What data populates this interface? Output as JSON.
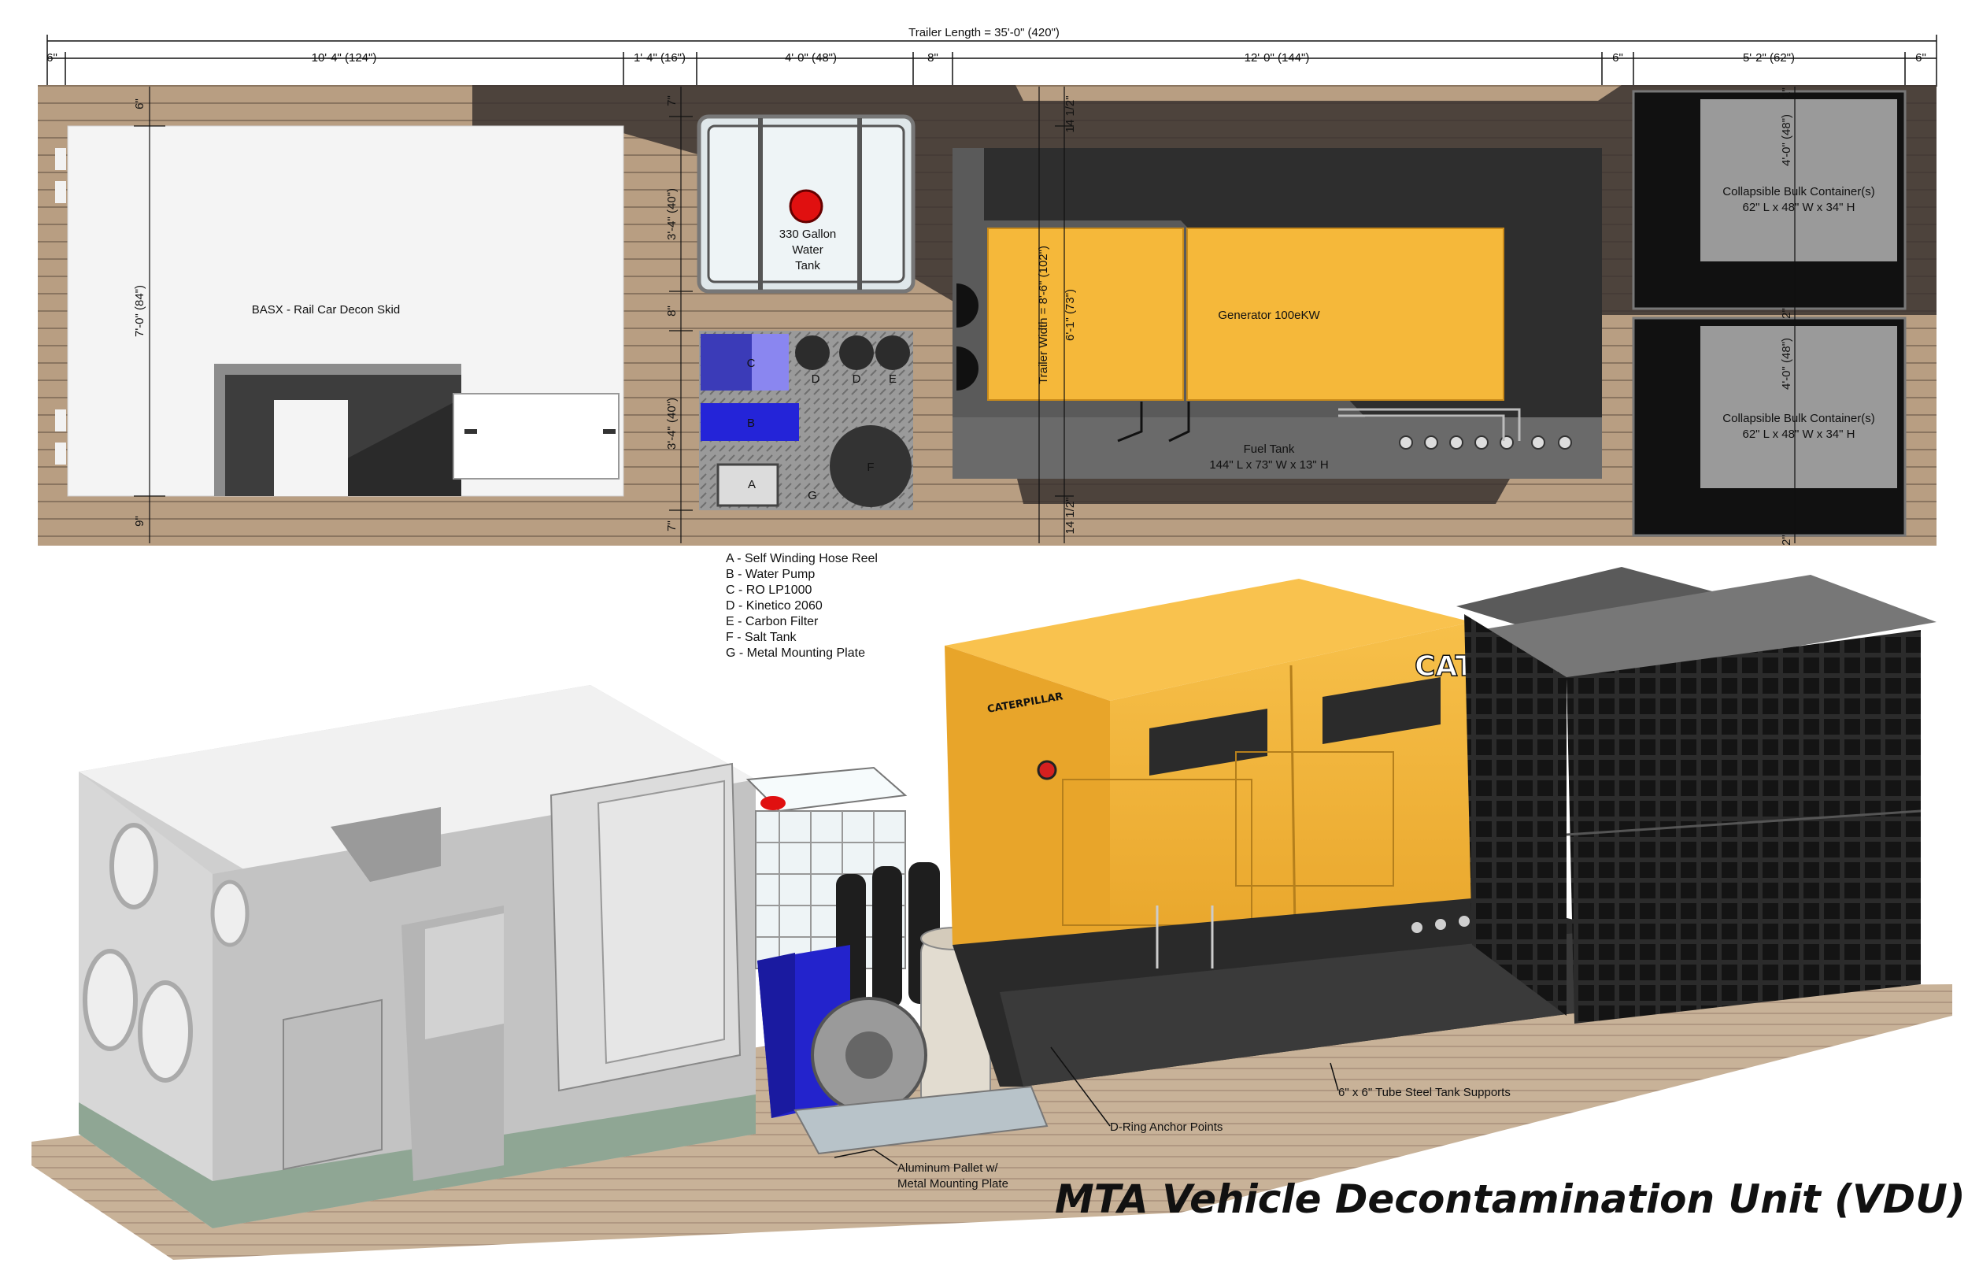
{
  "dimensions": {
    "overall": "Trailer Length = 35'-0\" (420\")",
    "segments": [
      "6\"",
      "10'-4\" (124\")",
      "1'-4\" (16\")",
      "4'-0\" (48\")",
      "8\"",
      "12'-0\" (144\")",
      "6\"",
      "5'-2\" (62\")",
      "6\""
    ],
    "skid_height": "7'-0\" (84\")",
    "skid_top": "6\"",
    "skid_bottom": "9\"",
    "water_top": "7\"",
    "water_depth": "3'-4\" (40\")",
    "water_gap": "8\"",
    "pump_depth": "3'-4\" (40\")",
    "pump_bottom": "7\"",
    "trailer_width": "Trailer Width = 8'-6\" (102\")",
    "gen_width": "6'-1\" (73\")",
    "gen_top": "14 1/2\"",
    "gen_bottom": "14 1/2\"",
    "bulk_top": "2\"",
    "bulk_1": "4'-0\" (48\")",
    "bulk_mid": "2\"",
    "bulk_2": "4'-0\" (48\")",
    "bulk_bottom": "2\""
  },
  "plan": {
    "skid_label": "BASX - Rail Car Decon Skid",
    "water_tank_label": [
      "330 Gallon",
      "Water",
      "Tank"
    ],
    "equip_letters": {
      "a": "A",
      "b": "B",
      "c": "C",
      "d1": "D",
      "d2": "D",
      "e": "E",
      "f": "F",
      "g": "G"
    },
    "generator_label": "Generator 100eKW",
    "fuel_tank_label": [
      "Fuel Tank",
      "144\" L x 73\" W x 13\" H"
    ],
    "bulk_label": [
      "Collapsible Bulk Container(s)",
      "62\" L x 48\" W x 34\" H"
    ]
  },
  "legend": [
    "A - Self Winding Hose Reel",
    "B - Water Pump",
    "C - RO LP1000",
    "D - Kinetico 2060",
    "E - Carbon Filter",
    "F - Salt Tank",
    "G - Metal Mounting Plate"
  ],
  "callouts": {
    "tank_supports": "6\" x 6\" Tube Steel Tank Supports",
    "d_ring": "D-Ring Anchor Points",
    "pallet": [
      "Aluminum Pallet w/",
      "Metal Mounting Plate"
    ]
  },
  "brand": {
    "cat": "CAT",
    "caterpillar": "CATERPILLAR"
  },
  "title": "MTA Vehicle Decontamination Unit (VDU)",
  "colors": {
    "generator_yellow": "#F5B83A",
    "deck_wood": "#B89E82",
    "pump_blue": "#3A3AE0",
    "skid_gray": "#C9C9C9"
  }
}
